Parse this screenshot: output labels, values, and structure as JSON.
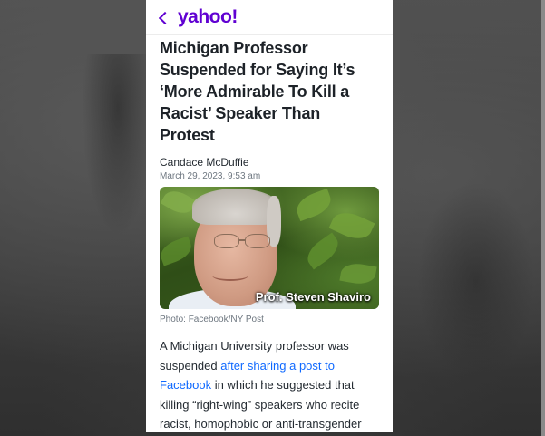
{
  "topbar": {
    "back_label": "Back",
    "logo": "yahoo!"
  },
  "article": {
    "headline": "Michigan Professor Suspended for Saying It’s ‘More Admirable To Kill a Racist’ Speaker Than Protest",
    "author": "Candace McDuffie",
    "date": "March 29, 2023, 9:53 am",
    "photo_overlay": "Prof. Steven Shaviro",
    "photo_credit": "Photo: Facebook/NY Post",
    "body_before_link": "A Michigan University professor was suspended ",
    "link_text": "after sharing a post to Facebook",
    "body_after_link": " in which he suggested that killing “right-wing” speakers who recite racist, homophobic or anti-transgender"
  },
  "colors": {
    "brand": "#6001d2",
    "link": "#0f69ff",
    "headline": "#1d2228",
    "meta": "#6e7780"
  }
}
